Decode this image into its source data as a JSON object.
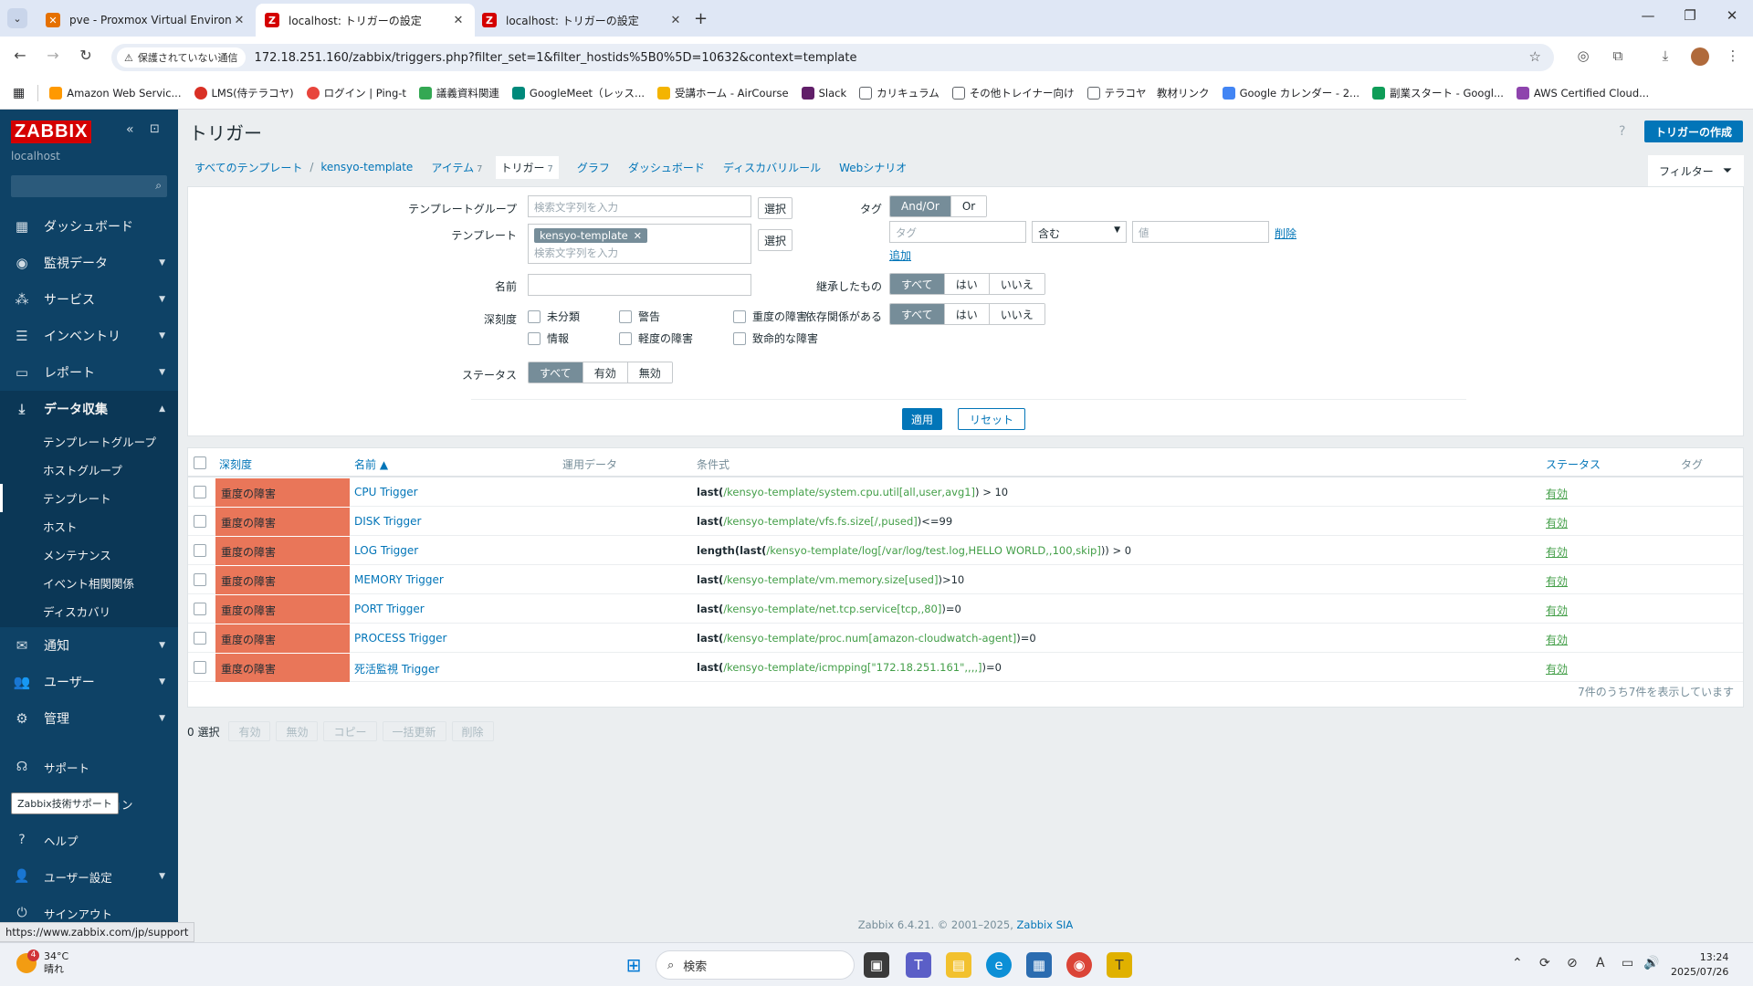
{
  "browser": {
    "tabs": [
      {
        "title": "pve - Proxmox Virtual Environm",
        "active": false
      },
      {
        "title": "localhost: トリガーの設定",
        "active": true
      },
      {
        "title": "localhost: トリガーの設定",
        "active": false
      }
    ],
    "security_label": "保護されていない通信",
    "url": "172.18.251.160/zabbix/triggers.php?filter_set=1&filter_hostids%5B0%5D=10632&context=template",
    "bookmarks": [
      "Amazon Web Servic...",
      "LMS(侍テラコヤ)",
      "ログイン | Ping-t",
      "議義資料関連",
      "GoogleMeet（レッス...",
      "受講ホーム - AirCourse",
      "Slack",
      "カリキュラム",
      "その他トレイナー向け",
      "テラコヤ　教材リンク",
      "Google カレンダー - 2...",
      "副業スタート - Googl...",
      "AWS Certified Cloud..."
    ]
  },
  "sidebar": {
    "logo": "ZABBIX",
    "server": "localhost",
    "menu": [
      {
        "label": "ダッシュボード",
        "icon": "dashboard-icon"
      },
      {
        "label": "監視データ",
        "icon": "eye-icon"
      },
      {
        "label": "サービス",
        "icon": "services-icon"
      },
      {
        "label": "インベントリ",
        "icon": "list-icon"
      },
      {
        "label": "レポート",
        "icon": "report-icon"
      },
      {
        "label": "データ収集",
        "icon": "download-icon"
      }
    ],
    "submenu": [
      "テンプレートグループ",
      "ホストグループ",
      "テンプレート",
      "ホスト",
      "メンテナンス",
      "イベント相関関係",
      "ディスカバリ"
    ],
    "menu2": [
      {
        "label": "通知",
        "icon": "mail-icon"
      },
      {
        "label": "ユーザー",
        "icon": "users-icon"
      },
      {
        "label": "管理",
        "icon": "gear-icon"
      }
    ],
    "bottom": [
      {
        "label": "サポート",
        "icon": "headset-icon"
      },
      {
        "label": "ション",
        "icon": "integrations-icon"
      },
      {
        "label": "ヘルプ",
        "icon": "help-icon"
      },
      {
        "label": "ユーザー設定",
        "icon": "user-icon"
      },
      {
        "label": "サインアウト",
        "icon": "power-icon"
      }
    ],
    "tooltip": "Zabbix技術サポート"
  },
  "page": {
    "title": "トリガー",
    "create_button": "トリガーの作成",
    "breadcrumbs": {
      "all_templates": "すべてのテンプレート",
      "template": "kensyo-template",
      "items": "アイテム",
      "items_count": "7",
      "triggers": "トリガー",
      "triggers_count": "7",
      "graphs": "グラフ",
      "dashboards": "ダッシュボード",
      "discovery": "ディスカバリルール",
      "web": "Webシナリオ"
    },
    "filter_tab": "フィルター"
  },
  "filter": {
    "template_group_label": "テンプレートグループ",
    "template_label": "テンプレート",
    "name_label": "名前",
    "severity_label": "深刻度",
    "status_label": "ステータス",
    "search_placeholder": "検索文字列を入力",
    "select_button": "選択",
    "template_chip": "kensyo-template",
    "severities": [
      "未分類",
      "情報",
      "警告",
      "軽度の障害",
      "重度の障害",
      "致命的な障害"
    ],
    "status_options": [
      "すべて",
      "有効",
      "無効"
    ],
    "tags_label": "タグ",
    "tag_andor": "And/Or",
    "tag_or": "Or",
    "tag_placeholder": "タグ",
    "tag_operator": "含む",
    "value_placeholder": "値",
    "remove_link": "削除",
    "add_link": "追加",
    "inherited_label": "継承したもの",
    "dependencies_label": "依存関係がある",
    "yes_no": [
      "すべて",
      "はい",
      "いいえ"
    ],
    "apply": "適用",
    "reset": "リセット"
  },
  "table": {
    "headers": {
      "severity": "深刻度",
      "name": "名前 ▲",
      "operational": "運用データ",
      "expression": "条件式",
      "status": "ステータス",
      "tags": "タグ"
    },
    "rows": [
      {
        "severity": "重度の障害",
        "name": "CPU Trigger",
        "fn": "last(",
        "item": "/kensyo-template/system.cpu.util[all,user,avg1]",
        "rest": ") > 10",
        "status": "有効"
      },
      {
        "severity": "重度の障害",
        "name": "DISK Trigger",
        "fn": "last(",
        "item": "/kensyo-template/vfs.fs.size[/,pused]",
        "rest": ")<=99",
        "status": "有効"
      },
      {
        "severity": "重度の障害",
        "name": "LOG Trigger",
        "fn": "length(last(",
        "item": "/kensyo-template/log[/var/log/test.log,HELLO WORLD,,100,skip]",
        "rest": ")) > 0",
        "status": "有効"
      },
      {
        "severity": "重度の障害",
        "name": "MEMORY Trigger",
        "fn": "last(",
        "item": "/kensyo-template/vm.memory.size[used]",
        "rest": ")>10",
        "status": "有効"
      },
      {
        "severity": "重度の障害",
        "name": "PORT Trigger",
        "fn": "last(",
        "item": "/kensyo-template/net.tcp.service[tcp,,80]",
        "rest": ")=0",
        "status": "有効"
      },
      {
        "severity": "重度の障害",
        "name": "PROCESS Trigger",
        "fn": "last(",
        "item": "/kensyo-template/proc.num[amazon-cloudwatch-agent]",
        "rest": ")=0",
        "status": "有効"
      },
      {
        "severity": "重度の障害",
        "name": "死活監視 Trigger",
        "fn": "last(",
        "item": "/kensyo-template/icmpping[\"172.18.251.161\",,,,]",
        "rest": ")=0",
        "status": "有効"
      }
    ],
    "footer": "7件のうち7件を表示しています"
  },
  "mass_actions": {
    "selected": "0 選択",
    "buttons": [
      "有効",
      "無効",
      "コピー",
      "一括更新",
      "削除"
    ]
  },
  "footer": {
    "text": "Zabbix 6.4.21. © 2001–2025,",
    "link": "Zabbix SIA"
  },
  "status_url": "https://www.zabbix.com/jp/support",
  "taskbar": {
    "weather_temp": "34°C",
    "weather_desc": "晴れ",
    "weather_badge": "4",
    "search_label": "検索",
    "time": "13:24",
    "date": "2025/07/26"
  },
  "colors": {
    "zabbix_nav": "#0e4266",
    "accent": "#0275b8",
    "severity_high": "#e97659",
    "status_enabled": "#429e47"
  }
}
